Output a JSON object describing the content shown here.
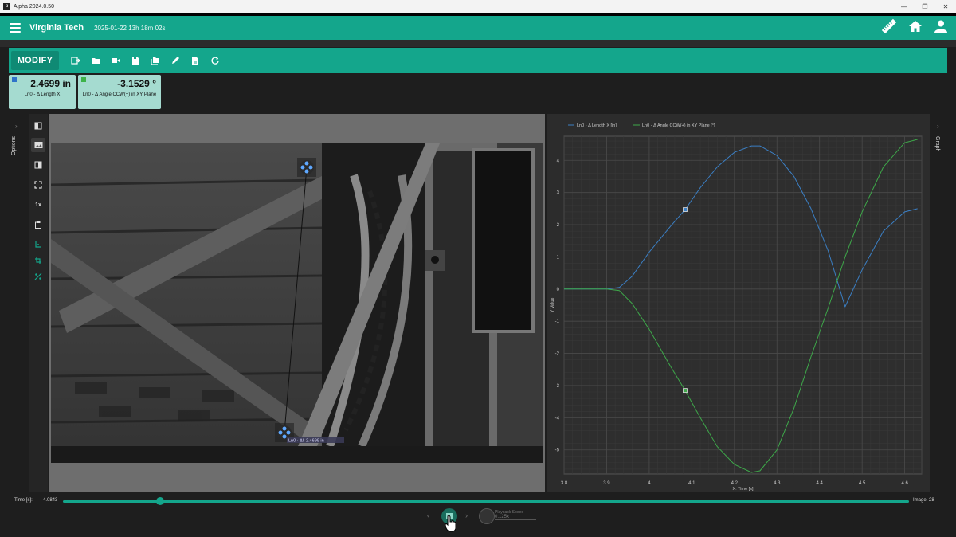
{
  "window": {
    "title": "Alpha 2024.0.50",
    "controls": [
      "—",
      "❐",
      "✕"
    ]
  },
  "header": {
    "brand": "Virginia Tech",
    "timestamp": "2025-01-22 13h 18m 02s",
    "icons": [
      "ruler-icon",
      "home-icon",
      "user-icon"
    ]
  },
  "toolbar": {
    "modify_label": "MODIFY",
    "icons": [
      "export-icon",
      "open-folder-icon",
      "video-icon",
      "save-icon",
      "folders-icon",
      "edit-icon",
      "document-icon",
      "refresh-icon"
    ]
  },
  "measurements": [
    {
      "value": "2.4699 in",
      "label": "Ln0 -  Δ Length X",
      "color": "#2f73c9"
    },
    {
      "value": "-3.1529 °",
      "label": "Ln0 -  Δ Angle CCW(+) in XY Plane",
      "color": "#3db34a"
    }
  ],
  "sidebar": {
    "options_label": "Options",
    "zoom_label": "1x"
  },
  "graph_panel": {
    "label": "Graph"
  },
  "viewer": {
    "annotation_text": "Ln0 · Δl: 2.4699 in"
  },
  "timeline": {
    "label": "Time [s]:",
    "value": "4.0843",
    "image_label": "Image: 28",
    "progress": 0.115
  },
  "playback": {
    "speed_label": "Playback Speed",
    "speed_value": "0.125x"
  },
  "chart_data": {
    "type": "line",
    "xlabel": "X: Time [s]",
    "ylabel": "Y Value",
    "xlim": [
      3.8,
      4.64
    ],
    "ylim": [
      -5.75,
      4.75
    ],
    "x_ticks": [
      3.8,
      3.9,
      4,
      4.1,
      4.2,
      4.3,
      4.4,
      4.5,
      4.6
    ],
    "y_ticks": [
      -5,
      -4,
      -3,
      -2,
      -1,
      0,
      1,
      2,
      3,
      4
    ],
    "grid": true,
    "legend_position": "top-left",
    "series": [
      {
        "name": "Ln0 -  Δ Length X [in]",
        "color": "#3b7fc4",
        "x": [
          3.8,
          3.85,
          3.9,
          3.93,
          3.96,
          4.0,
          4.05,
          4.0843,
          4.12,
          4.16,
          4.2,
          4.24,
          4.26,
          4.3,
          4.34,
          4.38,
          4.42,
          4.46,
          4.5,
          4.55,
          4.6,
          4.63
        ],
        "y": [
          0,
          0,
          0,
          0.05,
          0.4,
          1.15,
          1.95,
          2.47,
          3.15,
          3.8,
          4.25,
          4.45,
          4.45,
          4.15,
          3.5,
          2.5,
          1.2,
          -0.55,
          0.6,
          1.8,
          2.4,
          2.5
        ]
      },
      {
        "name": "Ln0 -  Δ Angle CCW(+) in XY Plane [°]",
        "color": "#3ea84a",
        "x": [
          3.8,
          3.85,
          3.9,
          3.93,
          3.96,
          4.0,
          4.05,
          4.0843,
          4.12,
          4.16,
          4.2,
          4.24,
          4.26,
          4.3,
          4.34,
          4.38,
          4.42,
          4.46,
          4.5,
          4.55,
          4.6,
          4.63
        ],
        "y": [
          0,
          0,
          0,
          -0.05,
          -0.45,
          -1.25,
          -2.4,
          -3.15,
          -4.0,
          -4.9,
          -5.45,
          -5.7,
          -5.65,
          -5.0,
          -3.7,
          -2.1,
          -0.6,
          1.0,
          2.4,
          3.8,
          4.55,
          4.65
        ]
      }
    ],
    "markers": [
      {
        "series": 0,
        "x": 4.0843,
        "y": 2.4699
      },
      {
        "series": 1,
        "x": 4.0843,
        "y": -3.1529
      }
    ]
  }
}
